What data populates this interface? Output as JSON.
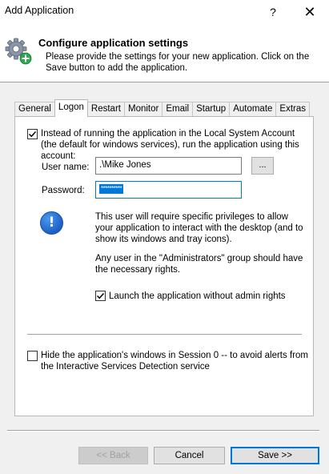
{
  "window": {
    "title": "Add Application",
    "help_glyph": "?",
    "close_glyph": "✕"
  },
  "header": {
    "title": "Configure application settings",
    "description": "Please provide the settings for your new application. Click on the Save button to add the application."
  },
  "tabs": [
    {
      "label": "General",
      "active": false
    },
    {
      "label": "Logon",
      "active": true
    },
    {
      "label": "Restart",
      "active": false
    },
    {
      "label": "Monitor",
      "active": false
    },
    {
      "label": "Email",
      "active": false
    },
    {
      "label": "Startup",
      "active": false
    },
    {
      "label": "Automate",
      "active": false
    },
    {
      "label": "Extras",
      "active": false
    }
  ],
  "logon": {
    "run_as_account": {
      "checked": true,
      "label": "Instead of running the application in the Local System Account (the default for windows services), run the application using this account:"
    },
    "username": {
      "label": "User name:",
      "value": ".\\Mike Jones",
      "browse_label": "..."
    },
    "password": {
      "label": "Password:",
      "value": "**********"
    },
    "info_icon": "!",
    "info_text_1": "This user will require specific privileges to allow your application to interact with the desktop (and to show its windows and tray icons).",
    "info_text_2": "Any user in the \"Administrators\" group should have the necessary rights.",
    "launch_without_admin": {
      "checked": true,
      "label": "Launch the application without admin rights"
    },
    "hide_session0": {
      "checked": false,
      "label": "Hide the application's windows in Session 0 -- to avoid alerts from the Interactive Services Detection service"
    }
  },
  "buttons": {
    "back": "<< Back",
    "cancel": "Cancel",
    "save": "Save >>"
  },
  "colors": {
    "accent": "#0078d7",
    "dialog_bg": "#f0f0f0"
  }
}
